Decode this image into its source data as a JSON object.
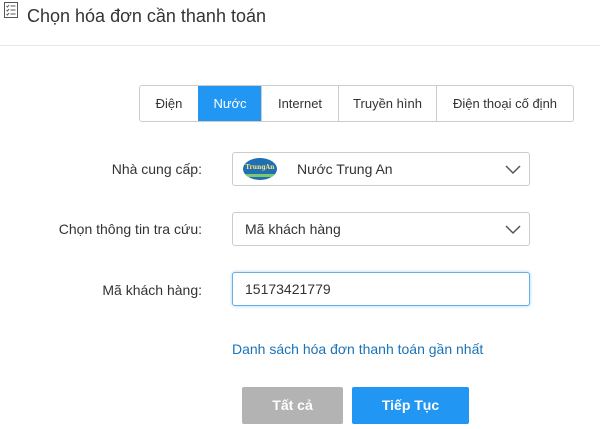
{
  "header": {
    "title": "Chọn hóa đơn cần thanh toán",
    "icon": "checklist-icon"
  },
  "tabs": [
    {
      "label": "Điện",
      "active": false
    },
    {
      "label": "Nước",
      "active": true
    },
    {
      "label": "Internet",
      "active": false
    },
    {
      "label": "Truyền hình",
      "active": false
    },
    {
      "label": "Điện thoại cố định",
      "active": false
    }
  ],
  "form": {
    "provider": {
      "label": "Nhà cung cấp:",
      "value": "Nước Trung An",
      "logo_text": "TrungAn"
    },
    "lookup": {
      "label": "Chọn thông tin tra cứu:",
      "value": "Mã khách hàng"
    },
    "customer_code": {
      "label": "Mã khách hàng:",
      "value": "15173421779"
    }
  },
  "recent_link": "Danh sách hóa đơn thanh toán gần nhất",
  "buttons": {
    "all": "Tất cả",
    "next": "Tiếp Tục"
  },
  "colors": {
    "accent": "#2196f3",
    "link": "#1a73b8",
    "disabled": "#b3b3b3"
  }
}
